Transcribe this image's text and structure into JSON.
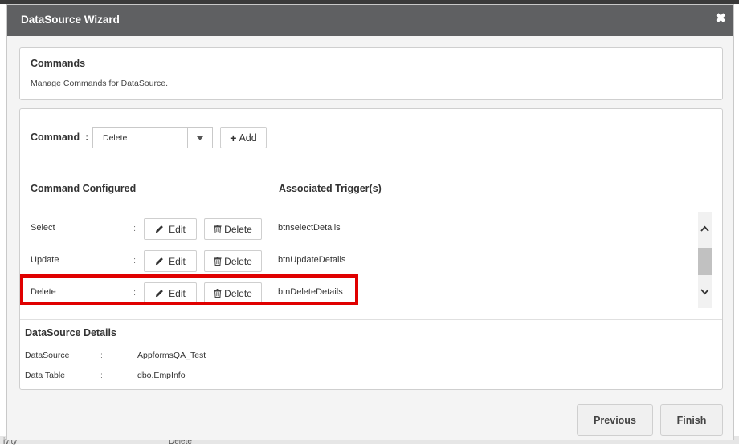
{
  "dialog": {
    "title": "DataSource Wizard",
    "close_glyph": "✖"
  },
  "commands_panel": {
    "heading": "Commands",
    "description": "Manage Commands for DataSource."
  },
  "command_selector": {
    "label": "Command",
    "colon": ":",
    "selected": "Delete",
    "add_label": "Add",
    "add_icon": "plus-icon"
  },
  "columns": {
    "configured": "Command Configured",
    "triggers": "Associated Trigger(s)"
  },
  "actions": {
    "edit_label": "Edit",
    "delete_label": "Delete",
    "edit_icon": "pencil-icon",
    "delete_icon": "trash-icon"
  },
  "rows": [
    {
      "name": "Select",
      "colon": ":",
      "trigger": "btnselectDetails"
    },
    {
      "name": "Update",
      "colon": ":",
      "trigger": "btnUpdateDetails"
    },
    {
      "name": "Delete",
      "colon": ":",
      "trigger": "btnDeleteDetails"
    }
  ],
  "datasource_details": {
    "heading": "DataSource Details",
    "items": [
      {
        "label": "DataSource",
        "colon": ":",
        "value": "AppformsQA_Test"
      },
      {
        "label": "Data Table",
        "colon": ":",
        "value": "dbo.EmpInfo"
      }
    ]
  },
  "footer": {
    "previous_label": "Previous",
    "finish_label": "Finish"
  },
  "background": {
    "left_fragment": "ivity",
    "mid_fragment": "Delete"
  },
  "colors": {
    "header_bg": "#5f6062",
    "highlight": "#e00000"
  }
}
